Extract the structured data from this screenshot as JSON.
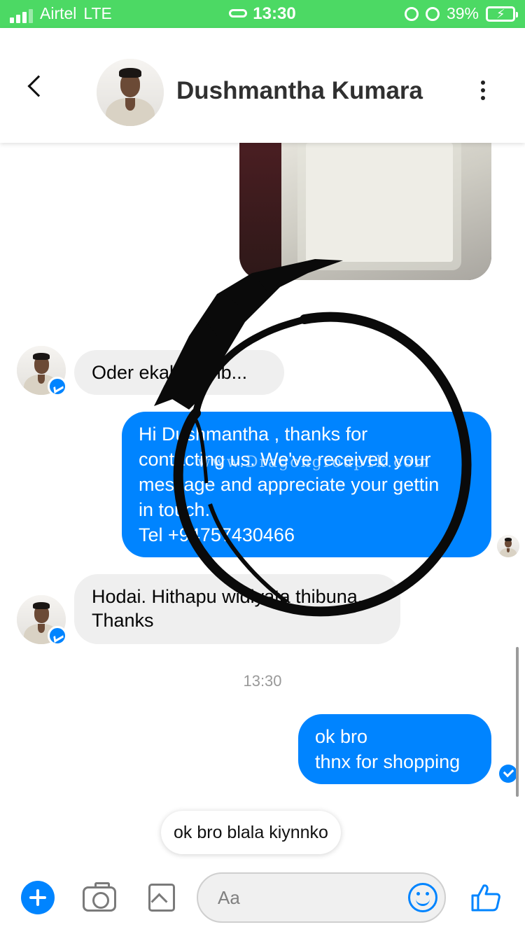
{
  "status_bar": {
    "carrier": "Airtel",
    "network": "LTE",
    "time": "13:30",
    "battery": "39%",
    "battery_level": 0.39,
    "icons": [
      "signal-icon",
      "link-icon",
      "orientation-lock-icon",
      "alarm-icon",
      "battery-charging-icon"
    ]
  },
  "header": {
    "contact_name": "Dushmantha Kumara",
    "icons": [
      "back-chevron-icon",
      "avatar",
      "more-vertical-icon"
    ]
  },
  "messages": [
    {
      "from": "them",
      "text": "Oder ekak dumb..."
    },
    {
      "from": "me",
      "text": "Hi Dushmantha , thanks for\ncontacting us. We've received your\nmessage and appreciate your gettin\nin touch.\nTel +94757430466"
    },
    {
      "from": "them",
      "text": "Hodai. Hithapu widiyata thibuna.\nThanks"
    },
    {
      "from": "me",
      "text": "ok bro\nthnx for shopping"
    }
  ],
  "timestamp": "13:30",
  "watermark": "www.Dragongroup1k.com",
  "quick_reply": "ok bro blala kiynnko",
  "composer": {
    "placeholder": "Aa",
    "icons": [
      "plus-icon",
      "camera-icon",
      "gallery-icon",
      "emoji-icon",
      "thumbs-up-icon"
    ]
  },
  "colors": {
    "status_bar": "#4cd964",
    "accent": "#0084ff",
    "incoming_bubble": "#efefef"
  }
}
